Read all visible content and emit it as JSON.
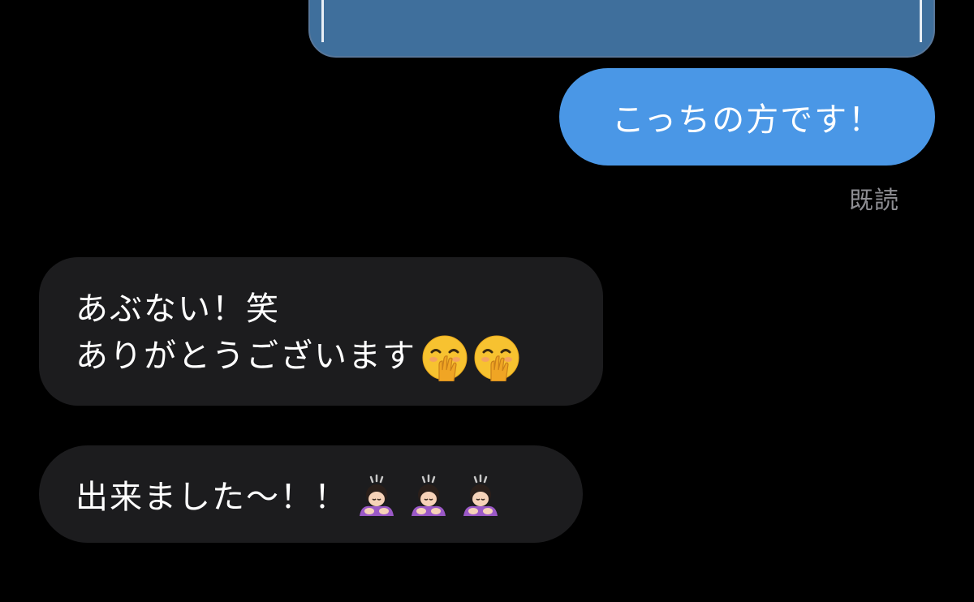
{
  "conversation": {
    "outgoing": {
      "message": "こっちの方です！",
      "read_receipt": "既読"
    },
    "incoming": [
      {
        "lines": [
          "あぶない！笑",
          "ありがとうございます"
        ],
        "emoji": [
          "hand-over-mouth-icon",
          "hand-over-mouth-icon"
        ]
      },
      {
        "text": "出来ました〜！！",
        "emoji": [
          "bowing-woman-icon",
          "bowing-woman-icon",
          "bowing-woman-icon"
        ]
      }
    ]
  },
  "colors": {
    "background": "#000000",
    "outgoing_bubble": "#4a97e6",
    "incoming_bubble": "#1c1c1e",
    "attachment": "#3f6f9c",
    "read_receipt": "#8e8e93"
  }
}
